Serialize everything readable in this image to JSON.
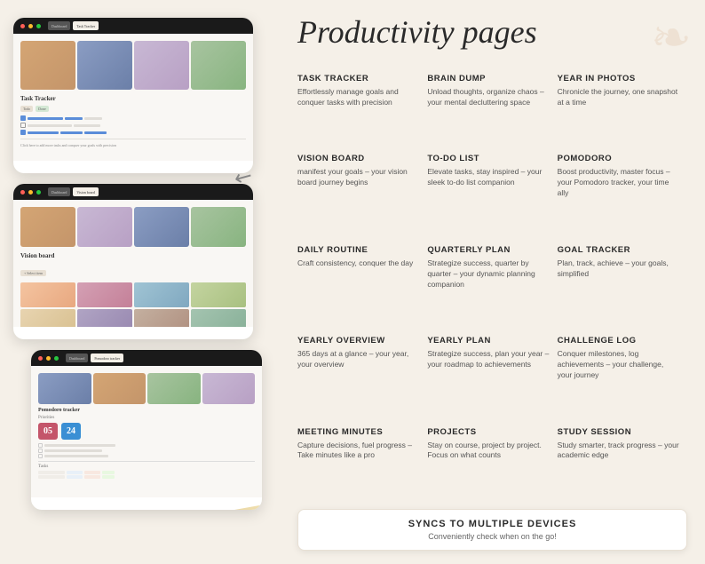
{
  "page": {
    "title": "Productivity pages",
    "background_color": "#f5f0e8"
  },
  "header": {
    "title": "Productivity pages"
  },
  "devices": [
    {
      "id": "task-tracker-device",
      "label": "Task Tracker",
      "type": "tablet-top"
    },
    {
      "id": "vision-board-device",
      "label": "Vision board",
      "type": "tablet-middle"
    },
    {
      "id": "pomodoro-device",
      "label": "Pomodoro tracker",
      "type": "tablet-bottom"
    }
  ],
  "pomodoro": {
    "minutes": "05",
    "seconds": "24"
  },
  "features": [
    {
      "id": "task-tracker",
      "title": "TASK TRACKER",
      "desc": "Effortlessly manage goals and conquer tasks with precision"
    },
    {
      "id": "brain-dump",
      "title": "BRAIN DUMP",
      "desc": "Unload thoughts, organize chaos – your mental decluttering space"
    },
    {
      "id": "year-in-photos",
      "title": "YEAR IN PHOTOS",
      "desc": "Chronicle the journey, one snapshot at a time"
    },
    {
      "id": "vision-board",
      "title": "VISION BOARD",
      "desc": "manifest your goals – your vision board journey begins"
    },
    {
      "id": "to-do-list",
      "title": "TO-DO LIST",
      "desc": "Elevate tasks, stay inspired – your sleek to-do list companion"
    },
    {
      "id": "pomodoro",
      "title": "POMODORO",
      "desc": "Boost productivity, master focus – your Pomodoro tracker, your time ally"
    },
    {
      "id": "daily-routine",
      "title": "DAILY ROUTINE",
      "desc": "Craft consistency, conquer the day"
    },
    {
      "id": "quarterly-plan",
      "title": "QUARTERLY PLAN",
      "desc": "Strategize success, quarter by quarter – your dynamic planning companion"
    },
    {
      "id": "goal-tracker",
      "title": "GOAL TRACKER",
      "desc": "Plan, track, achieve – your goals, simplified"
    },
    {
      "id": "yearly-overview",
      "title": "YEARLY OVERVIEW",
      "desc": "365 days at a glance – your year, your overview"
    },
    {
      "id": "yearly-plan",
      "title": "YEARLY PLAN",
      "desc": "Strategize success, plan your year – your roadmap to achievements"
    },
    {
      "id": "challenge-log",
      "title": "CHALLENGE LOG",
      "desc": "Conquer milestones, log achievements – your challenge, your journey"
    },
    {
      "id": "meeting-minutes",
      "title": "MEETING MINUTES",
      "desc": "Capture decisions, fuel progress – Take minutes like a pro"
    },
    {
      "id": "projects",
      "title": "PROJECTS",
      "desc": "Stay on course, project by project. Focus on what counts"
    },
    {
      "id": "study-session",
      "title": "STUDY SESSION",
      "desc": "Study smarter, track progress – your academic edge"
    }
  ],
  "sync_banner": {
    "title": "SYNCS TO MULTIPLE DEVICES",
    "desc": "Conveniently check when on the go!"
  }
}
